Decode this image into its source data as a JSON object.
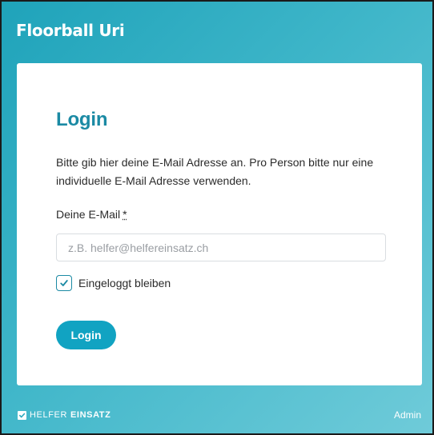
{
  "header": {
    "title": "Floorball Uri"
  },
  "login": {
    "heading": "Login",
    "intro": "Bitte gib hier deine E-Mail Adresse an. Pro Person bitte nur eine individuelle E-Mail Adresse verwenden.",
    "email_label": "Deine E-Mail",
    "required_mark": "*",
    "email_placeholder": "z.B. helfer@helfereinsatz.ch",
    "email_value": "",
    "stay_logged_in_label": "Eingeloggt bleiben",
    "stay_logged_in_checked": true,
    "submit_label": "Login"
  },
  "footer": {
    "logo_light": "HELFER",
    "logo_bold": "EINSATZ",
    "admin_label": "Admin"
  },
  "icons": {
    "checkbox": "checkmark-icon",
    "logo": "helfereinsatz-logo-icon"
  },
  "colors": {
    "accent": "#1b8aa4",
    "button": "#11a3c2",
    "background_start": "#1fa3ba",
    "background_end": "#6fcbd9"
  }
}
